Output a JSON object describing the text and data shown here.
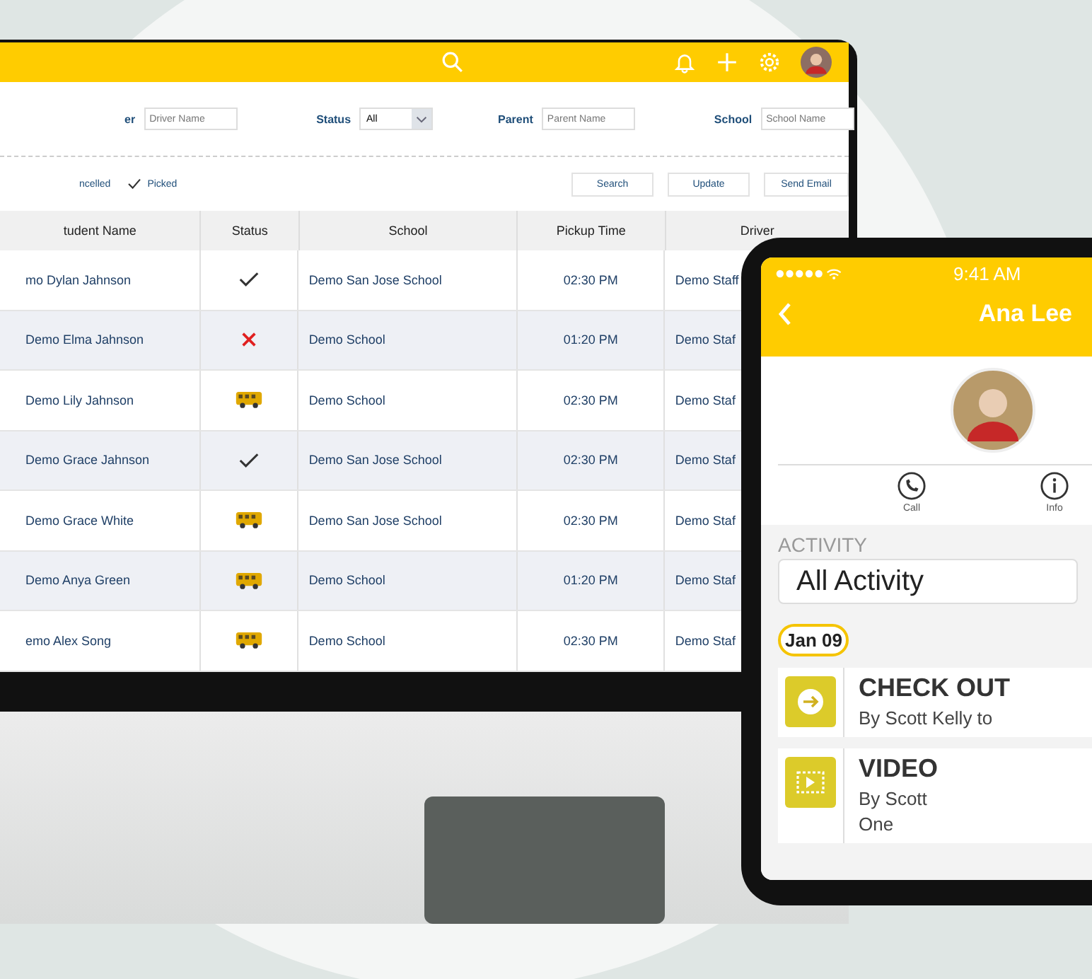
{
  "filters": [
    {
      "kind": "text",
      "label": "er",
      "placeholder": "Driver Name"
    },
    {
      "kind": "select",
      "label": "Status",
      "value": "All"
    },
    {
      "kind": "text",
      "label": "Parent",
      "placeholder": "Parent Name"
    },
    {
      "kind": "text",
      "label": "School",
      "placeholder": "School Name"
    }
  ],
  "legend": [
    {
      "kind": "cancelled",
      "label": "ncelled"
    },
    {
      "kind": "picked",
      "label": "Picked"
    }
  ],
  "actions": [
    "Search",
    "Update",
    "Send Email"
  ],
  "table": {
    "columns": [
      "tudent Name",
      "Status",
      "School",
      "Pickup Time",
      "Driver"
    ],
    "rows": [
      {
        "student": "mo Dylan Jahnson",
        "kind": "picked",
        "school": "Demo San Jose School",
        "pickup_time": "02:30 PM",
        "driver": "Demo Staff"
      },
      {
        "student": "Demo Elma Jahnson",
        "kind": "cancelled",
        "school": "Demo School",
        "pickup_time": "01:20 PM",
        "driver": "Demo Staf"
      },
      {
        "student": "Demo Lily Jahnson",
        "kind": "bus",
        "school": "Demo School",
        "pickup_time": "02:30 PM",
        "driver": "Demo Staf"
      },
      {
        "student": "Demo Grace Jahnson",
        "kind": "picked",
        "school": "Demo San Jose School",
        "pickup_time": "02:30 PM",
        "driver": "Demo Staf"
      },
      {
        "student": "Demo Grace White",
        "kind": "bus",
        "school": "Demo San Jose School",
        "pickup_time": "02:30 PM",
        "driver": "Demo Staf"
      },
      {
        "student": "Demo Anya Green",
        "kind": "bus",
        "school": "Demo School",
        "pickup_time": "01:20 PM",
        "driver": "Demo Staf"
      },
      {
        "student": "emo Alex Song",
        "kind": "bus",
        "school": "Demo School",
        "pickup_time": "02:30 PM",
        "driver": "Demo Staf"
      }
    ]
  },
  "phone": {
    "time": "9:41 AM",
    "title": "Ana Lee",
    "actions": [
      {
        "kind": "call",
        "label": "Call"
      },
      {
        "kind": "info",
        "label": "Info"
      }
    ],
    "section_title": "ACTIVITY",
    "filter_value": "All Activity",
    "date": "Jan 09",
    "timeline": [
      {
        "kind": "checkout",
        "title": "CHECK OUT",
        "lines": [
          "By Scott Kelly to"
        ]
      },
      {
        "kind": "video",
        "title": "VIDEO",
        "lines": [
          "By Scott",
          "One"
        ]
      }
    ]
  }
}
